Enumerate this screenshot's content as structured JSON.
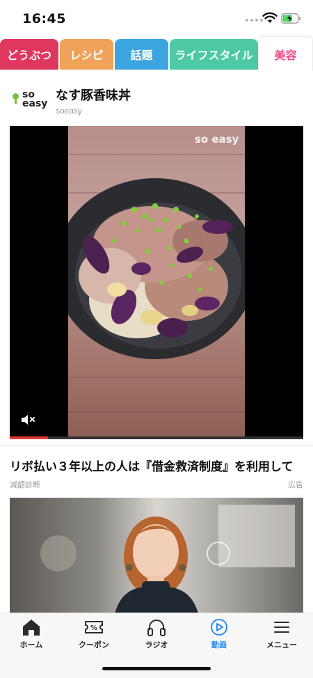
{
  "status_bar": {
    "time": "16:45"
  },
  "tabs": [
    {
      "label": "どうぶつ",
      "color": "#e0375e"
    },
    {
      "label": "レシピ",
      "color": "#f0a259"
    },
    {
      "label": "話題",
      "color": "#3aa5de"
    },
    {
      "label": "ライフスタイル",
      "color": "#4ec9a6"
    },
    {
      "label": "美容",
      "color": "#ee4a8c",
      "active": true
    }
  ],
  "article": {
    "logo_text": "so easy",
    "title": "なす豚香味丼",
    "source": "soeasy",
    "video": {
      "watermark": "so easy",
      "progress_percent": 13,
      "muted": true
    }
  },
  "ad": {
    "title": "リボ払い３年以上の人は『借金救済制度』を利用して",
    "source": "減額診断",
    "label": "広告"
  },
  "bottom_nav": [
    {
      "label": "ホーム",
      "icon": "home-icon"
    },
    {
      "label": "クーポン",
      "icon": "coupon-icon"
    },
    {
      "label": "ラジオ",
      "icon": "headphones-icon"
    },
    {
      "label": "動画",
      "icon": "play-icon",
      "active": true
    },
    {
      "label": "メニュー",
      "icon": "menu-icon"
    }
  ],
  "colors": {
    "active_nav": "#2d8cf0",
    "progress": "#e53935"
  }
}
